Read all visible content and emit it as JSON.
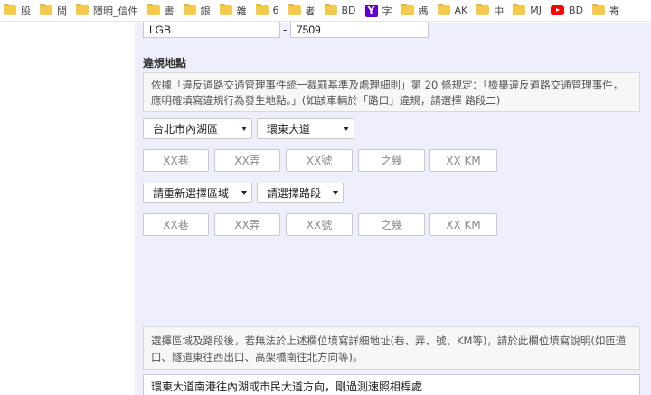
{
  "bookmarks": [
    {
      "icon": "folder-icon",
      "label": "股"
    },
    {
      "icon": "folder-icon",
      "label": "間"
    },
    {
      "icon": "folder-icon",
      "label": "隱明_信件"
    },
    {
      "icon": "folder-icon",
      "label": "書"
    },
    {
      "icon": "folder-icon",
      "label": "銀"
    },
    {
      "icon": "folder-icon",
      "label": "雜"
    },
    {
      "icon": "folder-icon",
      "label": "6"
    },
    {
      "icon": "folder-icon",
      "label": "者"
    },
    {
      "icon": "folder-icon",
      "label": "BD"
    },
    {
      "icon": "yahoo-icon",
      "label": "字"
    },
    {
      "icon": "folder-icon",
      "label": "媽"
    },
    {
      "icon": "folder-icon",
      "label": "AK"
    },
    {
      "icon": "folder-icon",
      "label": "中"
    },
    {
      "icon": "folder-icon",
      "label": "MJ"
    },
    {
      "icon": "youtube-icon",
      "label": "BD"
    },
    {
      "icon": "folder-icon",
      "label": "寄"
    }
  ],
  "plate": {
    "prefix": "LGB",
    "separator": "-",
    "number": "7509"
  },
  "violation_location": {
    "title": "違規地點",
    "info": "依據「違反道路交通管理事件統一裁罰基準及處理細則」第 20 條規定：「檢舉違反道路交通管理事件，應明確填寫違規行為發生地點。」(如該車輛於「路口」違規，請選擇 路段二)",
    "segment1": {
      "district": "台北市內湖區",
      "road": "環東大道",
      "lane_placeholder": "XX巷",
      "alley_placeholder": "XX弄",
      "number_placeholder": "XX號",
      "of_placeholder": "之幾",
      "km_placeholder": "XX KM"
    },
    "segment2": {
      "district": "請重新選擇區域",
      "road": "請選擇路段",
      "lane_placeholder": "XX巷",
      "alley_placeholder": "XX弄",
      "number_placeholder": "XX號",
      "of_placeholder": "之幾",
      "km_placeholder": "XX KM"
    },
    "note": "選擇區域及路段後，若無法於上述欄位填寫詳細地址(巷、弄、號、KM等)，請於此欄位填寫說明(如匝道口、隧道東往西出口、高架橋南往北方向等)。",
    "description": "環東大道南港往內湖或市民大道方向，剛過測速照相桿處"
  },
  "colors": {
    "panel_bg": "#eeeefc",
    "folder": "#f3c94e",
    "yahoo": "#5f01d1",
    "youtube": "#ff0000"
  }
}
